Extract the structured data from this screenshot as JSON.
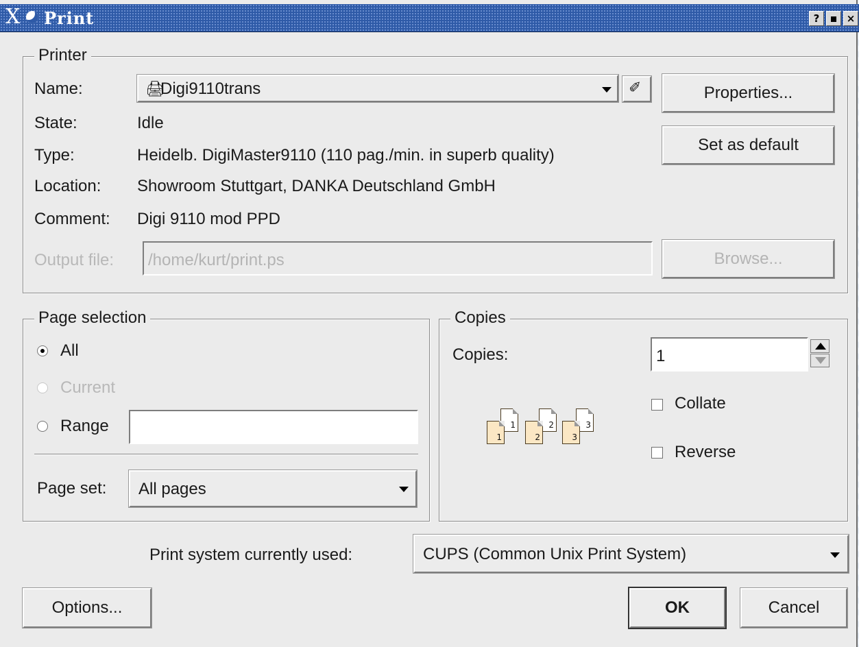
{
  "window": {
    "title": "Print"
  },
  "printer": {
    "legend": "Printer",
    "name_label": "Name:",
    "name_value": "Digi9110trans",
    "state_label": "State:",
    "state_value": "Idle",
    "type_label": "Type:",
    "type_value": "Heidelb. DigiMaster9110 (110 pag./min. in superb quality)",
    "location_label": "Location:",
    "location_value": "Showroom Stuttgart, DANKA Deutschland GmbH",
    "comment_label": "Comment:",
    "comment_value": "Digi 9110 mod PPD",
    "output_label": "Output file:",
    "output_value": "/home/kurt/print.ps",
    "properties_label": "Properties...",
    "default_label": "Set as default",
    "browse_label": "Browse..."
  },
  "pages": {
    "legend": "Page selection",
    "all_label": "All",
    "current_label": "Current",
    "range_label": "Range",
    "range_value": "",
    "selected": "All",
    "pageset_label": "Page set:",
    "pageset_value": "All pages"
  },
  "copies": {
    "legend": "Copies",
    "copies_label": "Copies:",
    "copies_value": "1",
    "collate_label": "Collate",
    "collate_checked": false,
    "reverse_label": "Reverse",
    "reverse_checked": false,
    "page_numbers": [
      "1",
      "1",
      "2",
      "2",
      "3",
      "3"
    ]
  },
  "print_system": {
    "label": "Print system currently used:",
    "value": "CUPS (Common Unix Print System)"
  },
  "footer": {
    "options_label": "Options...",
    "ok_label": "OK",
    "cancel_label": "Cancel"
  },
  "icons": [
    "x-logo-icon",
    "app-icon",
    "help-icon",
    "maximize-icon",
    "close-icon",
    "printer-icon",
    "wizard-icon",
    "chevron-down-icon",
    "spin-up-icon",
    "spin-down-icon",
    "collate-pages-icon"
  ]
}
